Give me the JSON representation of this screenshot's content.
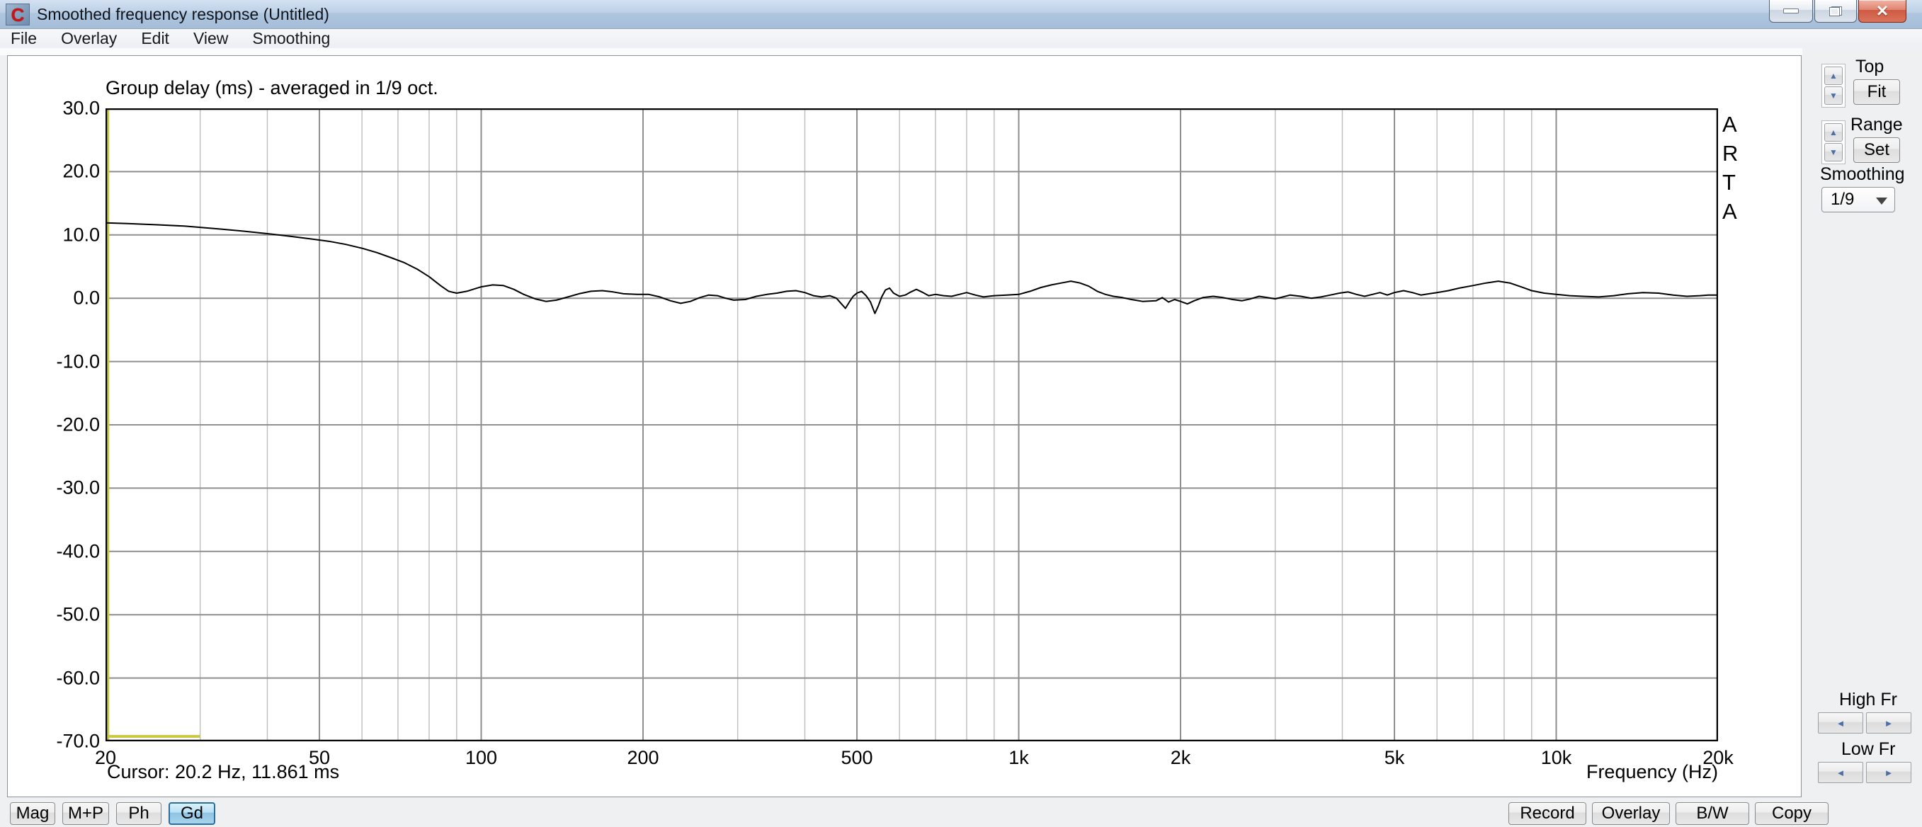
{
  "window": {
    "icon_letter": "C",
    "title": "Smoothed frequency response (Untitled)",
    "minimize_label": "minimize",
    "maximize_label": "restore",
    "close_label": "close"
  },
  "menu": {
    "items": [
      "File",
      "Overlay",
      "Edit",
      "View",
      "Smoothing"
    ]
  },
  "plot": {
    "arta_letters": [
      "A",
      "R",
      "T",
      "A"
    ],
    "cursor_status": "Cursor: 20.2 Hz, 11.861 ms"
  },
  "sidebar": {
    "top_label": "Top",
    "fit_button": "Fit",
    "range_label": "Range",
    "set_button": "Set",
    "smoothing_label": "Smoothing",
    "smoothing_value": "1/9",
    "high_fr_label": "High Fr",
    "low_fr_label": "Low Fr",
    "spin_up": "▲",
    "spin_down": "▼",
    "arrow_left": "◄",
    "arrow_right": "►"
  },
  "bottombar": {
    "view_buttons": [
      {
        "label": "Mag",
        "active": false
      },
      {
        "label": "M+P",
        "active": false
      },
      {
        "label": "Ph",
        "active": false
      },
      {
        "label": "Gd",
        "active": true
      }
    ],
    "action_buttons": [
      "Record",
      "Overlay",
      "B/W",
      "Copy"
    ]
  },
  "colors": {
    "curve": "#000000",
    "cursor_yellow": "#c9c943",
    "grid_minor": "#bdbdbd",
    "grid_major": "#8f8f8f",
    "selected_button_blue": "#a6d4ec"
  },
  "chart_data": {
    "type": "line",
    "title": "Group delay (ms) - averaged in 1/9 oct.",
    "xlabel": "Frequency (Hz)",
    "ylabel": "Group delay (ms)",
    "x_scale": "log",
    "xlim": [
      20,
      20000
    ],
    "ylim": [
      -70,
      30
    ],
    "grid": true,
    "legend": "none",
    "y_ticks": [
      30,
      20,
      10,
      0,
      -10,
      -20,
      -30,
      -40,
      -50,
      -60,
      -70
    ],
    "y_tick_labels": [
      "30.0",
      "20.0",
      "10.0",
      "0.0",
      "-10.0",
      "-20.0",
      "-30.0",
      "-40.0",
      "-50.0",
      "-60.0",
      "-70.0"
    ],
    "x_ticks": [
      {
        "f": 20,
        "label": "20"
      },
      {
        "f": 50,
        "label": "50"
      },
      {
        "f": 100,
        "label": "100"
      },
      {
        "f": 200,
        "label": "200"
      },
      {
        "f": 500,
        "label": "500"
      },
      {
        "f": 1000,
        "label": "1k"
      },
      {
        "f": 2000,
        "label": "2k"
      },
      {
        "f": 5000,
        "label": "5k"
      },
      {
        "f": 10000,
        "label": "10k"
      },
      {
        "f": 20000,
        "label": "20k"
      }
    ],
    "cursor": {
      "freq_hz": 20.2,
      "value_ms": 11.861,
      "baseline_marker_to_hz": 30
    },
    "series": [
      {
        "name": "group_delay_1_9_oct",
        "color": "#000000",
        "points": [
          [
            20,
            11.9
          ],
          [
            22,
            11.8
          ],
          [
            25,
            11.6
          ],
          [
            28,
            11.4
          ],
          [
            30,
            11.2
          ],
          [
            33,
            10.9
          ],
          [
            36,
            10.6
          ],
          [
            40,
            10.2
          ],
          [
            44,
            9.8
          ],
          [
            48,
            9.4
          ],
          [
            52,
            9.0
          ],
          [
            56,
            8.5
          ],
          [
            60,
            7.9
          ],
          [
            64,
            7.2
          ],
          [
            68,
            6.4
          ],
          [
            72,
            5.6
          ],
          [
            76,
            4.6
          ],
          [
            80,
            3.4
          ],
          [
            84,
            2.0
          ],
          [
            87,
            1.1
          ],
          [
            90,
            0.8
          ],
          [
            94,
            1.1
          ],
          [
            100,
            1.8
          ],
          [
            105,
            2.1
          ],
          [
            110,
            2.0
          ],
          [
            115,
            1.4
          ],
          [
            120,
            0.6
          ],
          [
            126,
            -0.1
          ],
          [
            132,
            -0.5
          ],
          [
            138,
            -0.3
          ],
          [
            145,
            0.2
          ],
          [
            152,
            0.7
          ],
          [
            160,
            1.1
          ],
          [
            168,
            1.2
          ],
          [
            176,
            1.0
          ],
          [
            184,
            0.7
          ],
          [
            195,
            0.6
          ],
          [
            205,
            0.6
          ],
          [
            215,
            0.2
          ],
          [
            225,
            -0.4
          ],
          [
            235,
            -0.8
          ],
          [
            245,
            -0.5
          ],
          [
            255,
            0.1
          ],
          [
            265,
            0.5
          ],
          [
            275,
            0.4
          ],
          [
            285,
            0.0
          ],
          [
            295,
            -0.3
          ],
          [
            310,
            -0.2
          ],
          [
            325,
            0.3
          ],
          [
            340,
            0.6
          ],
          [
            355,
            0.8
          ],
          [
            370,
            1.1
          ],
          [
            385,
            1.2
          ],
          [
            400,
            0.9
          ],
          [
            415,
            0.4
          ],
          [
            430,
            0.2
          ],
          [
            445,
            0.4
          ],
          [
            458,
            0.0
          ],
          [
            468,
            -0.9
          ],
          [
            476,
            -1.6
          ],
          [
            484,
            -0.6
          ],
          [
            492,
            0.3
          ],
          [
            500,
            0.8
          ],
          [
            510,
            1.1
          ],
          [
            520,
            0.4
          ],
          [
            530,
            -0.6
          ],
          [
            540,
            -2.4
          ],
          [
            548,
            -1.2
          ],
          [
            556,
            0.2
          ],
          [
            565,
            1.3
          ],
          [
            575,
            1.6
          ],
          [
            585,
            0.8
          ],
          [
            600,
            0.3
          ],
          [
            615,
            0.5
          ],
          [
            630,
            1.0
          ],
          [
            645,
            1.4
          ],
          [
            660,
            1.0
          ],
          [
            680,
            0.4
          ],
          [
            700,
            0.6
          ],
          [
            725,
            0.4
          ],
          [
            750,
            0.3
          ],
          [
            775,
            0.6
          ],
          [
            800,
            0.9
          ],
          [
            830,
            0.5
          ],
          [
            860,
            0.2
          ],
          [
            900,
            0.4
          ],
          [
            950,
            0.5
          ],
          [
            1000,
            0.6
          ],
          [
            1050,
            1.1
          ],
          [
            1100,
            1.7
          ],
          [
            1150,
            2.1
          ],
          [
            1200,
            2.4
          ],
          [
            1250,
            2.7
          ],
          [
            1300,
            2.4
          ],
          [
            1350,
            1.9
          ],
          [
            1400,
            1.1
          ],
          [
            1450,
            0.6
          ],
          [
            1500,
            0.3
          ],
          [
            1560,
            0.1
          ],
          [
            1620,
            -0.2
          ],
          [
            1700,
            -0.5
          ],
          [
            1800,
            -0.4
          ],
          [
            1850,
            0.1
          ],
          [
            1900,
            -0.6
          ],
          [
            1950,
            -0.2
          ],
          [
            2000,
            -0.5
          ],
          [
            2060,
            -0.9
          ],
          [
            2120,
            -0.4
          ],
          [
            2200,
            0.1
          ],
          [
            2300,
            0.3
          ],
          [
            2400,
            0.1
          ],
          [
            2500,
            -0.2
          ],
          [
            2600,
            -0.4
          ],
          [
            2700,
            -0.1
          ],
          [
            2800,
            0.3
          ],
          [
            2900,
            0.1
          ],
          [
            3000,
            -0.1
          ],
          [
            3100,
            0.2
          ],
          [
            3200,
            0.5
          ],
          [
            3350,
            0.3
          ],
          [
            3500,
            0.0
          ],
          [
            3650,
            0.2
          ],
          [
            3800,
            0.5
          ],
          [
            3950,
            0.8
          ],
          [
            4100,
            1.0
          ],
          [
            4250,
            0.6
          ],
          [
            4400,
            0.3
          ],
          [
            4550,
            0.6
          ],
          [
            4700,
            0.9
          ],
          [
            4850,
            0.5
          ],
          [
            5000,
            0.9
          ],
          [
            5200,
            1.2
          ],
          [
            5400,
            0.9
          ],
          [
            5600,
            0.5
          ],
          [
            5800,
            0.7
          ],
          [
            6000,
            0.9
          ],
          [
            6300,
            1.2
          ],
          [
            6600,
            1.6
          ],
          [
            7000,
            2.0
          ],
          [
            7400,
            2.4
          ],
          [
            7800,
            2.7
          ],
          [
            8200,
            2.4
          ],
          [
            8600,
            1.8
          ],
          [
            9000,
            1.2
          ],
          [
            9500,
            0.8
          ],
          [
            10000,
            0.6
          ],
          [
            10600,
            0.4
          ],
          [
            11200,
            0.3
          ],
          [
            12000,
            0.2
          ],
          [
            12800,
            0.4
          ],
          [
            13600,
            0.7
          ],
          [
            14500,
            0.9
          ],
          [
            15500,
            0.8
          ],
          [
            16500,
            0.5
          ],
          [
            17500,
            0.3
          ],
          [
            18500,
            0.4
          ],
          [
            19200,
            0.5
          ],
          [
            20000,
            0.5
          ]
        ]
      }
    ]
  }
}
